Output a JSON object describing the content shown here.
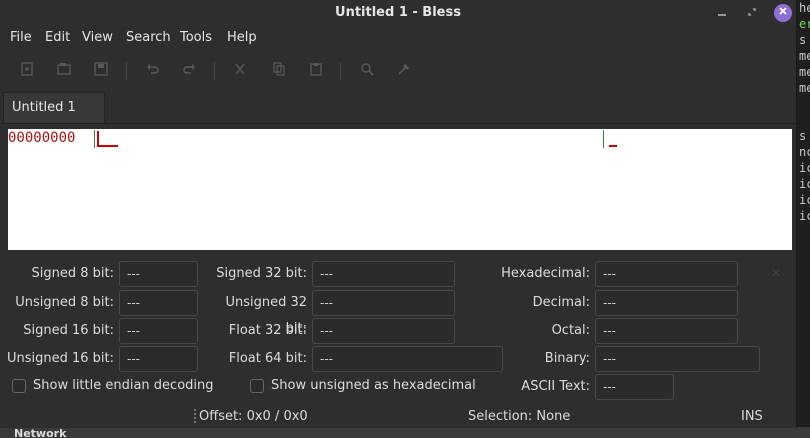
{
  "window": {
    "title": "Untitled 1 - Bless"
  },
  "background_terminal": {
    "lines": [
      "he",
      "er",
      "s",
      "me",
      "me",
      "me",
      "",
      "",
      "s",
      "nc",
      "ic",
      "ic",
      "ic",
      "ic"
    ],
    "bottom_label": "Network"
  },
  "menu": [
    "File",
    "Edit",
    "View",
    "Search",
    "Tools",
    "Help"
  ],
  "toolbar": [
    "new-file-icon",
    "open-icon",
    "save-icon",
    "undo-icon",
    "redo-icon",
    "cut-icon",
    "copy-icon",
    "paste-icon",
    "find-icon",
    "replace-icon"
  ],
  "tab": {
    "label": "Untitled 1"
  },
  "editor": {
    "offset": "00000000"
  },
  "converter": {
    "signed8": {
      "label": "Signed 8 bit:",
      "value": "---"
    },
    "unsigned8": {
      "label": "Unsigned 8 bit:",
      "value": "---"
    },
    "signed16": {
      "label": "Signed 16 bit:",
      "value": "---"
    },
    "unsigned16": {
      "label": "Unsigned 16 bit:",
      "value": "---"
    },
    "signed32": {
      "label": "Signed 32 bit:",
      "value": "---"
    },
    "unsigned32": {
      "label": "Unsigned 32 bit:",
      "value": "---"
    },
    "float32": {
      "label": "Float 32 bit:",
      "value": "---"
    },
    "float64": {
      "label": "Float 64 bit:",
      "value": "---"
    },
    "hex": {
      "label": "Hexadecimal:",
      "value": "---"
    },
    "decimal": {
      "label": "Decimal:",
      "value": "---"
    },
    "octal": {
      "label": "Octal:",
      "value": "---"
    },
    "binary": {
      "label": "Binary:",
      "value": "---"
    },
    "ascii": {
      "label": "ASCII Text:",
      "value": "---"
    },
    "little_endian_label": "Show little endian decoding",
    "unsigned_hex_label": "Show unsigned as hexadecimal"
  },
  "status": {
    "offset": "Offset: 0x0 / 0x0",
    "selection": "Selection: None",
    "mode": "INS"
  }
}
